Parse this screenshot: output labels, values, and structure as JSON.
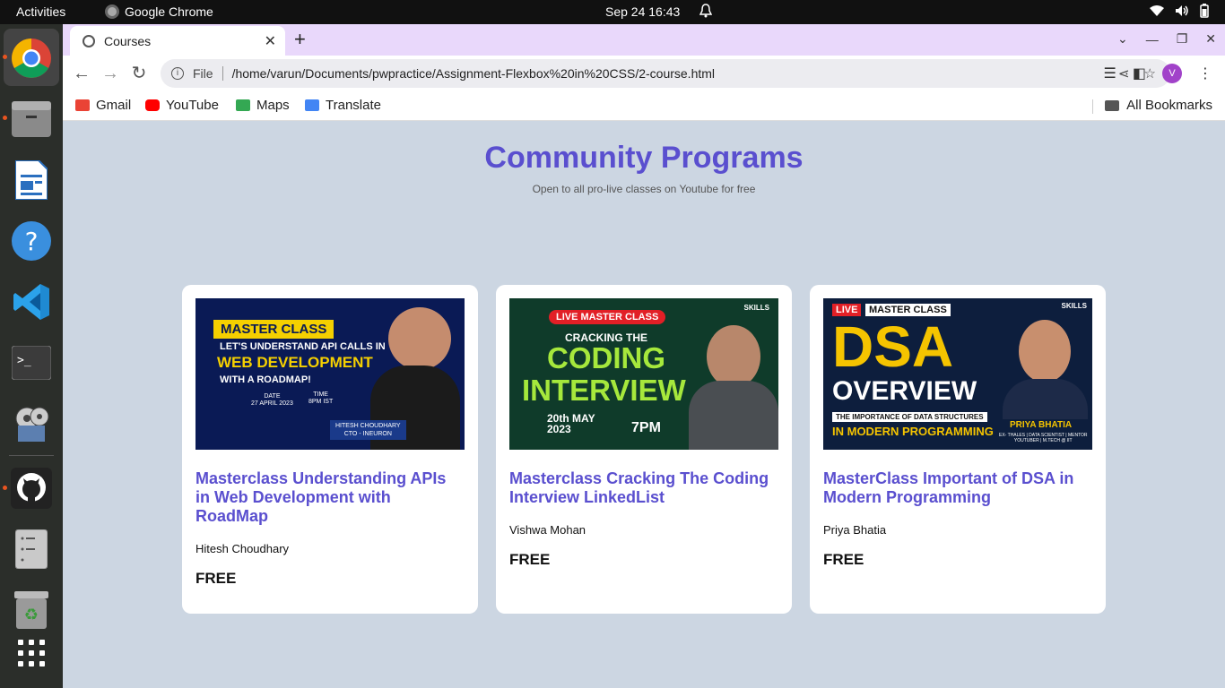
{
  "topbar": {
    "activities": "Activities",
    "app_name": "Google Chrome",
    "clock": "Sep 24  16:43"
  },
  "dock": {
    "items": [
      "chrome-icon",
      "files-icon",
      "writer-icon",
      "help-icon",
      "vscode-icon",
      "terminal-icon",
      "video-icon",
      "github-icon",
      "disk-icon",
      "trash-icon",
      "apps-grid-icon"
    ]
  },
  "browser": {
    "tab_title": "Courses",
    "url_scheme": "File",
    "url": "/home/varun/Documents/pwpractice/Assignment-Flexbox%20in%20CSS/2-course.html",
    "avatar_letter": "V",
    "bookmarks": [
      {
        "label": "Gmail",
        "color": "#ea4335"
      },
      {
        "label": "YouTube",
        "color": "#ff0000"
      },
      {
        "label": "Maps",
        "color": "#34a853"
      },
      {
        "label": "Translate",
        "color": "#4285f4"
      }
    ],
    "all_bookmarks": "All Bookmarks"
  },
  "page": {
    "title": "Community Programs",
    "subtitle": "Open to all pro-live classes on Youtube for free",
    "accent_color": "#5a4fcf",
    "background_color": "#ccd6e2",
    "courses": [
      {
        "title": "Masterclass Understanding APIs in Web Development with RoadMap",
        "author": "Hitesh Choudhary",
        "price": "FREE",
        "thumb": {
          "badge": "MASTER CLASS",
          "line1": "LET'S UNDERSTAND API CALLS IN",
          "line2": "WEB DEVELOPMENT",
          "line3": "WITH A ROADMAP!",
          "date": "DATE\n27 APRIL 2023",
          "time": "TIME\n8PM IST",
          "name": "HITESH CHOUDHARY\nCTO - INEURON"
        }
      },
      {
        "title": "Masterclass Cracking The Coding Interview LinkedList",
        "author": "Vishwa Mohan",
        "price": "FREE",
        "thumb": {
          "badge": "LIVE MASTER CLASS",
          "brand": "SKILLS",
          "line1": "CRACKING THE",
          "line2": "CODING",
          "line3": "INTERVIEW",
          "date": "20th MAY\n2023",
          "time": "7PM"
        }
      },
      {
        "title": "MasterClass Important of DSA in Modern Programming",
        "author": "Priya Bhatia",
        "price": "FREE",
        "thumb": {
          "live": "LIVE",
          "badge": "MASTER CLASS",
          "brand": "SKILLS",
          "line1": "DSA",
          "line2": "OVERVIEW",
          "line3": "THE IMPORTANCE OF DATA STRUCTURES",
          "line4": "IN MODERN PROGRAMMING",
          "name": "PRIYA BHATIA",
          "desc": "EX- THALES | DATA SCIENTIST | MENTOR\nYOUTUBER | M.TECH @ IIT"
        }
      }
    ]
  }
}
